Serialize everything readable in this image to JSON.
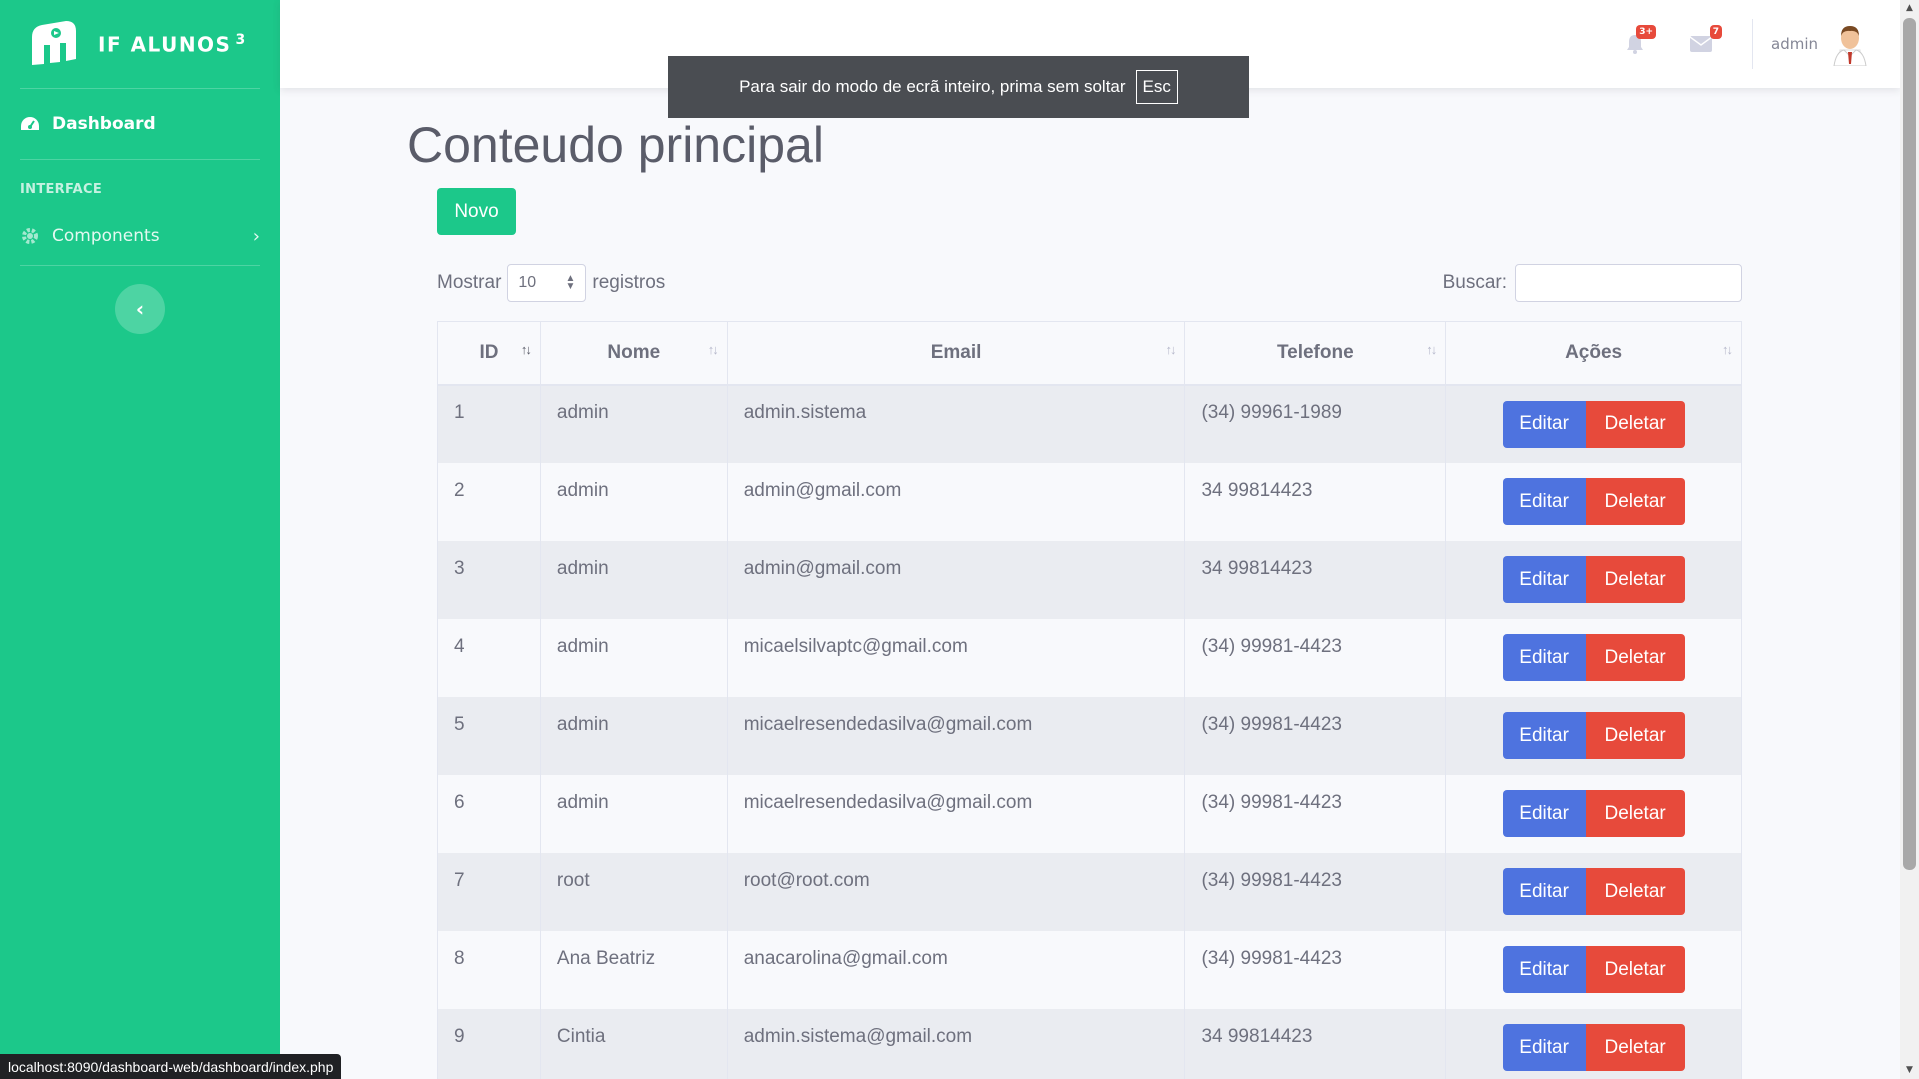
{
  "brand": {
    "name": "IF ALUNOS",
    "superscript": "3"
  },
  "sidebar": {
    "dashboard_label": "Dashboard",
    "section_heading": "INTERFACE",
    "components_label": "Components"
  },
  "topbar": {
    "alerts_badge": "3+",
    "messages_badge": "7",
    "user_name": "admin"
  },
  "fullscreen_notice": {
    "text": "Para sair do modo de ecrã inteiro, prima sem soltar",
    "key": "Esc"
  },
  "main": {
    "title": "Conteudo principal",
    "new_button": "Novo",
    "show_label": "Mostrar",
    "length_value": "10",
    "records_label": "registros",
    "search_label": "Buscar:",
    "search_value": ""
  },
  "table": {
    "columns": [
      "ID",
      "Nome",
      "Email",
      "Telefone",
      "Ações"
    ],
    "edit_label": "Editar",
    "delete_label": "Deletar",
    "rows": [
      {
        "id": "1",
        "nome": "admin",
        "email": "admin.sistema",
        "telefone": "(34) 99961-1989"
      },
      {
        "id": "2",
        "nome": "admin",
        "email": "admin@gmail.com",
        "telefone": "34 99814423"
      },
      {
        "id": "3",
        "nome": "admin",
        "email": "admin@gmail.com",
        "telefone": "34 99814423"
      },
      {
        "id": "4",
        "nome": "admin",
        "email": "micaelsilvaptc@gmail.com",
        "telefone": "(34) 99981-4423"
      },
      {
        "id": "5",
        "nome": "admin",
        "email": "micaelresendedasilva@gmail.com",
        "telefone": "(34) 99981-4423"
      },
      {
        "id": "6",
        "nome": "admin",
        "email": "micaelresendedasilva@gmail.com",
        "telefone": "(34) 99981-4423"
      },
      {
        "id": "7",
        "nome": "root",
        "email": "root@root.com",
        "telefone": "(34) 99981-4423"
      },
      {
        "id": "8",
        "nome": "Ana Beatriz",
        "email": "anacarolina@gmail.com",
        "telefone": "(34) 99981-4423"
      },
      {
        "id": "9",
        "nome": "Cintia",
        "email": "admin.sistema@gmail.com",
        "telefone": "34 99814423"
      }
    ]
  },
  "status_url": "localhost:8090/dashboard-web/dashboard/index.php",
  "colors": {
    "sidebar": "#1cc88a",
    "edit": "#4e73df",
    "delete": "#e74a3b",
    "new": "#1cc88a"
  }
}
